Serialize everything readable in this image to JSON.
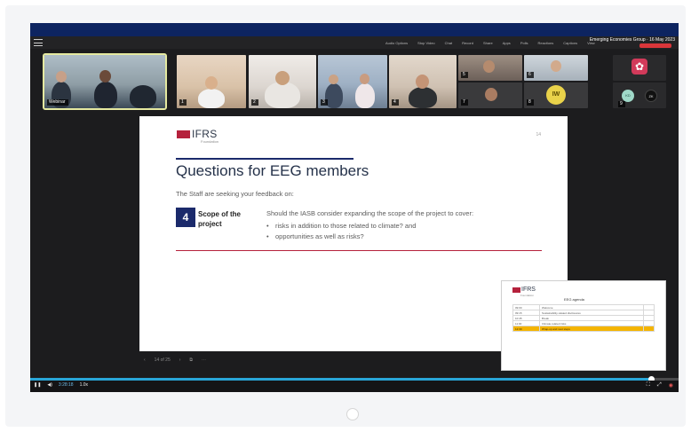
{
  "window": {
    "app_label": "",
    "event_title": "Emerging Economies Group · 16 May 2023"
  },
  "toolbar": {
    "items": [
      "Audio Options",
      "Stop Video",
      "Chat",
      "Record",
      "Share",
      "Apps",
      "Polls",
      "Reactions",
      "Captions",
      "View"
    ],
    "leave_label": ""
  },
  "participants": {
    "tile_numbers": [
      "1",
      "2",
      "3",
      "4",
      "5",
      "6",
      "7",
      "8",
      "9"
    ],
    "active_tile_name": "Webinar",
    "avatar_iw": "IW",
    "avatar_kd": "KD",
    "avatar_zk": "ZK"
  },
  "slide": {
    "logo_text": "IFRS",
    "logo_sub": "Foundation",
    "corner_mark": "14",
    "title": "Questions for EEG members",
    "subtitle": "The Staff are seeking your feedback on:",
    "item_number": "4",
    "item_label": "Scope of the project",
    "question": "Should the IASB consider expanding the scope of the project to cover:",
    "bullets": [
      "risks in addition to those related to climate? and",
      "opportunities as well as risks?"
    ]
  },
  "slide_tools": {
    "page_indicator": "14 of 25"
  },
  "agenda": {
    "logo_text": "IFRS",
    "logo_sub": "Foundation",
    "title": "EEG agenda",
    "rows": [
      [
        "09:00",
        "Welcome",
        ""
      ],
      [
        "09:15",
        "Sustainability-related disclosures",
        ""
      ],
      [
        "10:45",
        "Break",
        ""
      ],
      [
        "11:00",
        "Climate-related risks",
        ""
      ],
      [
        "12:30",
        "Wrap-up and next steps",
        ""
      ]
    ]
  },
  "player": {
    "progress_pct": 96,
    "time": "3:28:18",
    "speed": "1.0x"
  },
  "icons": {
    "menu": "hamburger-icon",
    "play": "pause-icon",
    "volume": "volume-icon",
    "fullscreen": "fullscreen-icon",
    "expand": "expand-icon",
    "camera": "camera-icon",
    "logo": "zoom-logo-icon",
    "pager": "pager-dot-icon"
  }
}
